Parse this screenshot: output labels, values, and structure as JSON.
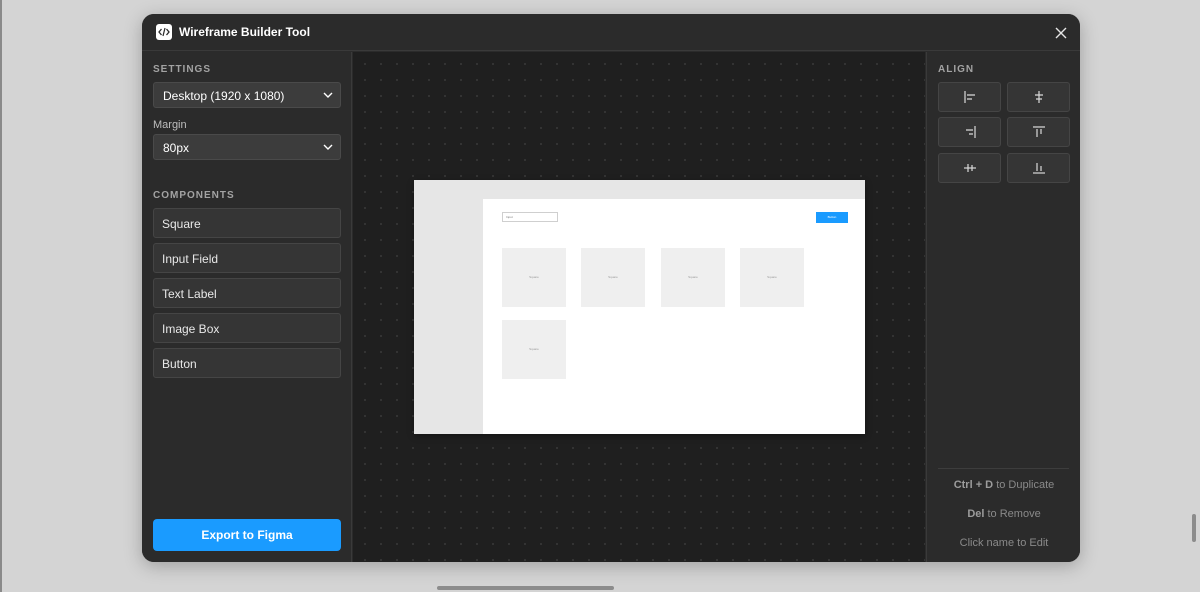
{
  "window": {
    "title": "Wireframe Builder Tool"
  },
  "settings": {
    "section_label": "SETTINGS",
    "device_value": "Desktop (1920 x 1080)",
    "margin_label": "Margin",
    "margin_value": "80px"
  },
  "components": {
    "section_label": "COMPONENTS",
    "items": [
      {
        "label": "Square"
      },
      {
        "label": "Input Field"
      },
      {
        "label": "Text Label"
      },
      {
        "label": "Image Box"
      },
      {
        "label": "Button"
      }
    ]
  },
  "export_label": "Export to Figma",
  "canvas": {
    "input_text": "Input",
    "button_text": "Button",
    "square_label": "Square"
  },
  "align": {
    "section_label": "ALIGN",
    "buttons": [
      {
        "icon": "align-left-icon"
      },
      {
        "icon": "align-center-horizontal-icon"
      },
      {
        "icon": "align-right-icon"
      },
      {
        "icon": "align-top-icon"
      },
      {
        "icon": "align-center-vertical-icon"
      },
      {
        "icon": "align-bottom-icon"
      }
    ]
  },
  "hints": [
    {
      "key": "Ctrl + D",
      "text": " to Duplicate"
    },
    {
      "key": "Del",
      "text": " to Remove"
    },
    {
      "key": "",
      "text": "Click name to Edit"
    }
  ],
  "colors": {
    "accent": "#1a9bff",
    "panel": "#2b2b2b",
    "canvas": "#1f1f1f"
  }
}
